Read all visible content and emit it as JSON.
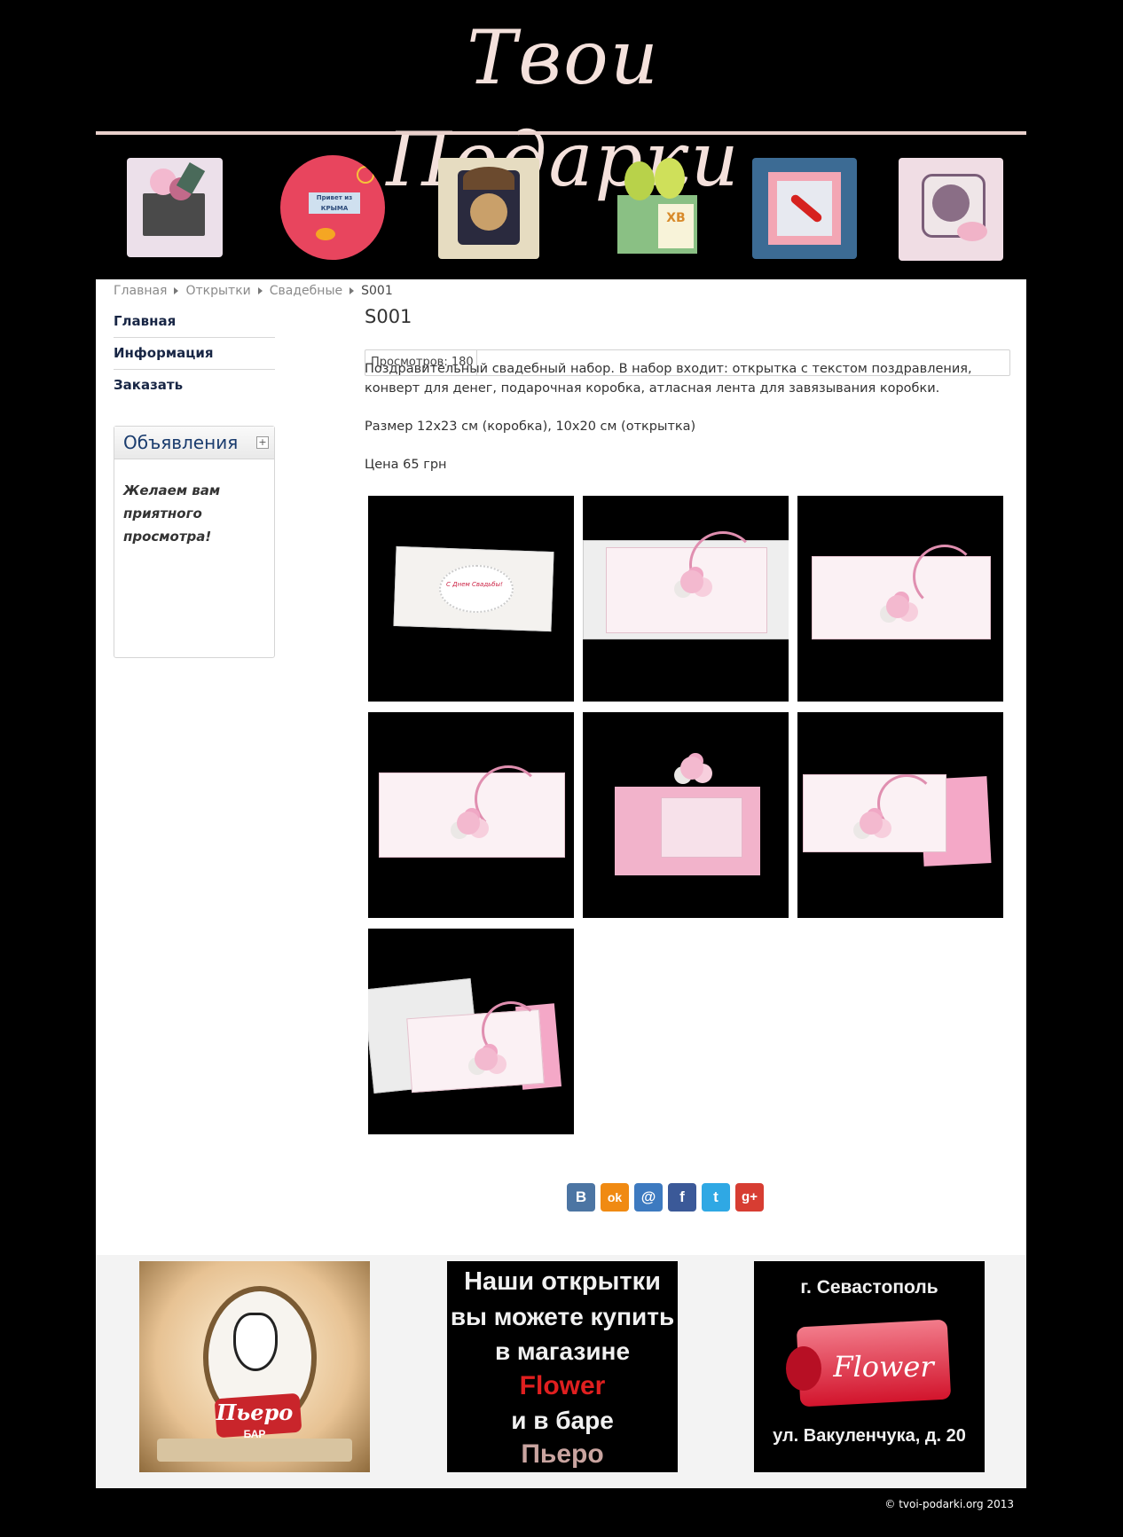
{
  "site": {
    "logo_text": "Твои Подарки",
    "copyright": "© tvoi-podarki.org 2013"
  },
  "banner": {
    "items": [
      {
        "name": "card-pink-flowers",
        "label": ""
      },
      {
        "name": "card-crimea",
        "label": "Привет из КРЫМА"
      },
      {
        "name": "card-mask",
        "label": ""
      },
      {
        "name": "box-easter",
        "label": "ХВ"
      },
      {
        "name": "card-chili",
        "label": ""
      },
      {
        "name": "card-lace",
        "label": ""
      }
    ]
  },
  "breadcrumb": {
    "items": [
      "Главная",
      "Открытки",
      "Свадебные"
    ],
    "current": "S001"
  },
  "sidemenu": {
    "items": [
      "Главная",
      "Информация",
      "Заказать"
    ]
  },
  "module": {
    "title": "Объявления",
    "toggle": "+",
    "body": [
      "Желаем вам",
      "приятного",
      "просмотра!"
    ]
  },
  "article": {
    "title": "S001",
    "hits": "Просмотров: 180",
    "paragraphs": [
      "Поздравительный свадебный набор. В набор входит: открытка с текстом поздравления, конверт для денег, подарочная коробка, атласная лента для завязывания коробки.",
      "Размер 12х23 см (коробка), 10х20 см (открытка)",
      "Цена 65 грн"
    ],
    "card_inscription": "С Днем Свадьбы!"
  },
  "share": {
    "buttons": [
      {
        "name": "vk",
        "glyph": "B",
        "color": "#4c75a3"
      },
      {
        "name": "odnoklassniki",
        "glyph": "ok",
        "color": "#f08a12"
      },
      {
        "name": "mailru",
        "glyph": "@",
        "color": "#3d7ac0"
      },
      {
        "name": "facebook",
        "glyph": "f",
        "color": "#3b5998"
      },
      {
        "name": "twitter",
        "glyph": "t",
        "color": "#2fa8e4"
      },
      {
        "name": "googleplus",
        "glyph": "g+",
        "color": "#d73d32"
      }
    ]
  },
  "ads": {
    "piero": {
      "sign": "Пьеро",
      "sub": "БАР"
    },
    "shop": {
      "lines": [
        "Наши открытки",
        "вы можете купить",
        "в магазине"
      ],
      "brand": "Flower",
      "line4": "и в баре",
      "bar": "Пьеро"
    },
    "flower": {
      "city": "г. Севастополь",
      "brand": "Flower",
      "address": "ул. Вакуленчука, д. 20"
    }
  }
}
